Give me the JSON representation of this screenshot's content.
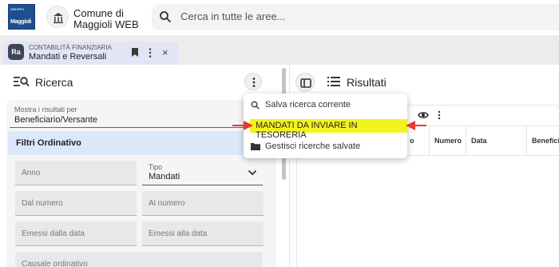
{
  "app": {
    "logo_top": "GRUPPO",
    "logo_word": "Maggioli",
    "title_line1": "Comune di",
    "title_line2": "Maggioli WEB",
    "search_placeholder": "Cerca in tutte le aree..."
  },
  "tab": {
    "avatar": "Ra",
    "subtitle": "CONTABILITÀ FINANZIARIA",
    "name": "Mandati e Reversali",
    "close": "×"
  },
  "left": {
    "title": "Ricerca",
    "show_label": "Mostra i risultati per",
    "show_value": "Beneficiario/Versante",
    "filters_title": "Filtri Ordinativo",
    "fields": {
      "anno": "Anno",
      "tipo_label": "Tipo",
      "tipo_value": "Mandati",
      "dal_numero": "Dal numero",
      "al_numero": "Al numero",
      "emessi_dalla": "Emessi dalla data",
      "emessi_alla": "Emessi alla data",
      "causale": "Causale ordinativo"
    }
  },
  "right": {
    "title": "Risultati",
    "toolbar_fragment": "i",
    "columns": [
      "o",
      "Numero",
      "Data",
      "Beneficiario"
    ]
  },
  "menu": {
    "items": [
      {
        "label": "Salva ricerca corrente",
        "icon": "search-icon"
      },
      {
        "label": "MANDATI DA INVIARE IN TESORERIA",
        "highlight_color": "#f3f31e"
      },
      {
        "label": "Gestisci ricerche salvate",
        "icon": "folder-icon"
      }
    ]
  },
  "colors": {
    "arrow": "#e53935",
    "filters_bg": "#dbe8fb",
    "logo_bg": "#1d4f91"
  }
}
